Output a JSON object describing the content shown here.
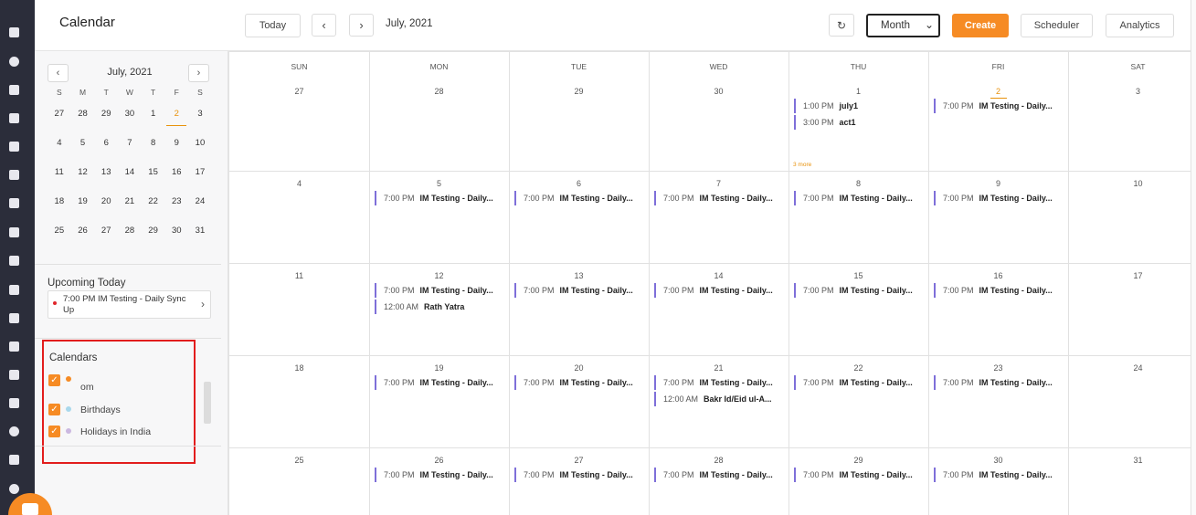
{
  "header": {
    "title": "Calendar",
    "today": "Today",
    "prev_icon": "‹",
    "next_icon": "›",
    "current_month": "July, 2021",
    "refresh_icon": "↻",
    "view": "Month",
    "view_chevron": "⌄",
    "create": "Create",
    "scheduler": "Scheduler",
    "analytics": "Analytics"
  },
  "mini": {
    "title": "July, 2021",
    "prev": "‹",
    "next": "›",
    "weekdays": [
      "S",
      "M",
      "T",
      "W",
      "T",
      "F",
      "S"
    ],
    "weeks": [
      [
        "27",
        "28",
        "29",
        "30",
        "1",
        "2",
        "3"
      ],
      [
        "4",
        "5",
        "6",
        "7",
        "8",
        "9",
        "10"
      ],
      [
        "11",
        "12",
        "13",
        "14",
        "15",
        "16",
        "17"
      ],
      [
        "18",
        "19",
        "20",
        "21",
        "22",
        "23",
        "24"
      ],
      [
        "25",
        "26",
        "27",
        "28",
        "29",
        "30",
        "31"
      ]
    ],
    "today": "2"
  },
  "upcoming": {
    "title": "Upcoming Today",
    "item": "7:00 PM IM Testing - Daily Sync Up",
    "arrow": "›"
  },
  "calendars": {
    "title": "Calendars",
    "check": "✓",
    "items": [
      {
        "label": "om",
        "color": "#f68b24"
      },
      {
        "label": "Birthdays",
        "color": "#a9d8ec"
      },
      {
        "label": "Holidays in India",
        "color": "#cbb8e0"
      }
    ]
  },
  "grid": {
    "weekdays": [
      "SUN",
      "MON",
      "TUE",
      "WED",
      "THU",
      "FRI",
      "SAT"
    ],
    "weeks": [
      {
        "days": [
          "27",
          "28",
          "29",
          "30",
          "1",
          "2",
          "3"
        ]
      },
      {
        "days": [
          "4",
          "5",
          "6",
          "7",
          "8",
          "9",
          "10"
        ]
      },
      {
        "days": [
          "11",
          "12",
          "13",
          "14",
          "15",
          "16",
          "17"
        ]
      },
      {
        "days": [
          "18",
          "19",
          "20",
          "21",
          "22",
          "23",
          "24"
        ]
      },
      {
        "days": [
          "25",
          "26",
          "27",
          "28",
          "29",
          "30",
          "31"
        ]
      }
    ],
    "today_cell": "2",
    "more_label": "3 more",
    "events": [
      {
        "w": 0,
        "d": 4,
        "slot": 0,
        "time": "1:00 PM",
        "name": "july1"
      },
      {
        "w": 0,
        "d": 4,
        "slot": 1,
        "time": "3:00 PM",
        "name": "act1"
      },
      {
        "w": 0,
        "d": 5,
        "slot": 0,
        "time": "7:00 PM",
        "name": "IM Testing - Daily..."
      },
      {
        "w": 1,
        "d": 1,
        "slot": 0,
        "time": "7:00 PM",
        "name": "IM Testing - Daily..."
      },
      {
        "w": 1,
        "d": 2,
        "slot": 0,
        "time": "7:00 PM",
        "name": "IM Testing - Daily..."
      },
      {
        "w": 1,
        "d": 3,
        "slot": 0,
        "time": "7:00 PM",
        "name": "IM Testing - Daily..."
      },
      {
        "w": 1,
        "d": 4,
        "slot": 0,
        "time": "7:00 PM",
        "name": "IM Testing - Daily..."
      },
      {
        "w": 1,
        "d": 5,
        "slot": 0,
        "time": "7:00 PM",
        "name": "IM Testing - Daily..."
      },
      {
        "w": 2,
        "d": 1,
        "slot": 0,
        "time": "7:00 PM",
        "name": "IM Testing - Daily..."
      },
      {
        "w": 2,
        "d": 1,
        "slot": 1,
        "time": "12:00 AM",
        "name": "Rath Yatra"
      },
      {
        "w": 2,
        "d": 2,
        "slot": 0,
        "time": "7:00 PM",
        "name": "IM Testing - Daily..."
      },
      {
        "w": 2,
        "d": 3,
        "slot": 0,
        "time": "7:00 PM",
        "name": "IM Testing - Daily..."
      },
      {
        "w": 2,
        "d": 4,
        "slot": 0,
        "time": "7:00 PM",
        "name": "IM Testing - Daily..."
      },
      {
        "w": 2,
        "d": 5,
        "slot": 0,
        "time": "7:00 PM",
        "name": "IM Testing - Daily..."
      },
      {
        "w": 3,
        "d": 1,
        "slot": 0,
        "time": "7:00 PM",
        "name": "IM Testing - Daily..."
      },
      {
        "w": 3,
        "d": 2,
        "slot": 0,
        "time": "7:00 PM",
        "name": "IM Testing - Daily..."
      },
      {
        "w": 3,
        "d": 3,
        "slot": 0,
        "time": "7:00 PM",
        "name": "IM Testing - Daily..."
      },
      {
        "w": 3,
        "d": 3,
        "slot": 1,
        "time": "12:00 AM",
        "name": "Bakr Id/Eid ul-A..."
      },
      {
        "w": 3,
        "d": 4,
        "slot": 0,
        "time": "7:00 PM",
        "name": "IM Testing - Daily..."
      },
      {
        "w": 3,
        "d": 5,
        "slot": 0,
        "time": "7:00 PM",
        "name": "IM Testing - Daily..."
      },
      {
        "w": 4,
        "d": 1,
        "slot": 0,
        "time": "7:00 PM",
        "name": "IM Testing - Daily..."
      },
      {
        "w": 4,
        "d": 2,
        "slot": 0,
        "time": "7:00 PM",
        "name": "IM Testing - Daily..."
      },
      {
        "w": 4,
        "d": 3,
        "slot": 0,
        "time": "7:00 PM",
        "name": "IM Testing - Daily..."
      },
      {
        "w": 4,
        "d": 4,
        "slot": 0,
        "time": "7:00 PM",
        "name": "IM Testing - Daily..."
      },
      {
        "w": 4,
        "d": 5,
        "slot": 0,
        "time": "7:00 PM",
        "name": "IM Testing - Daily..."
      }
    ]
  }
}
